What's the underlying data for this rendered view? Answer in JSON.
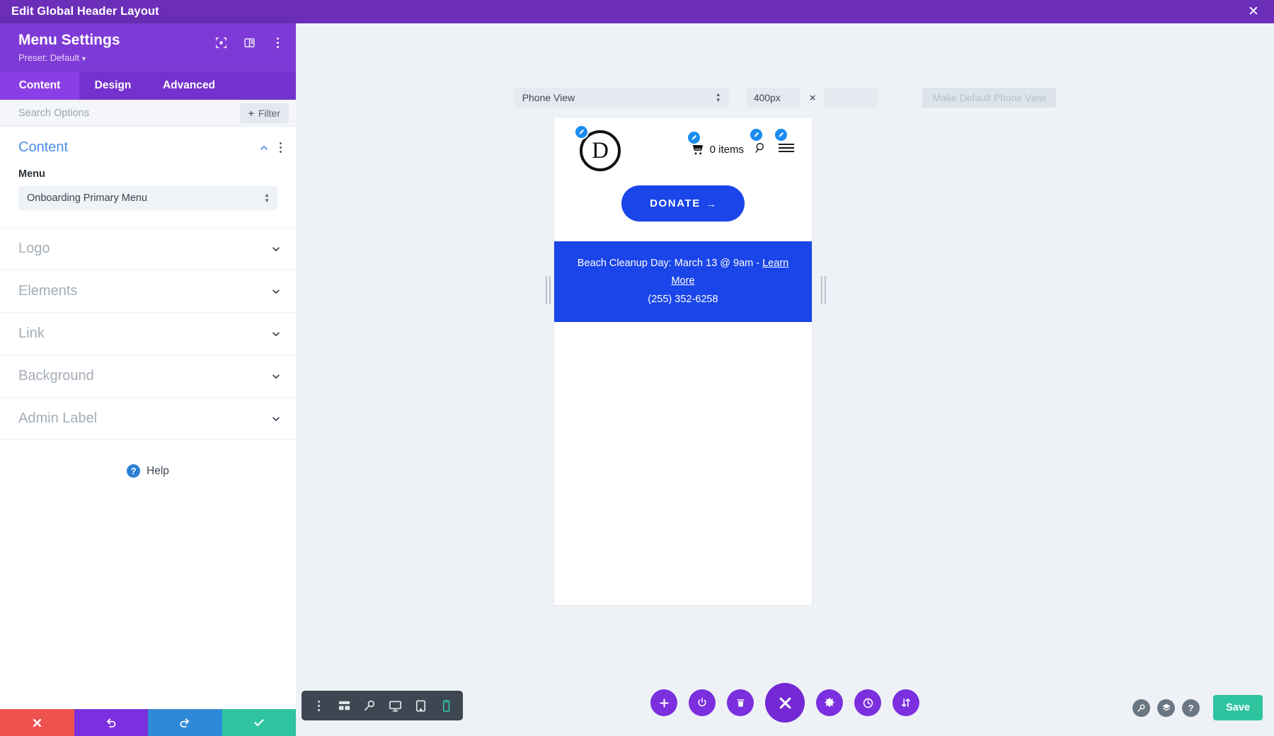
{
  "topbar": {
    "title": "Edit Global Header Layout",
    "close_icon": "close-icon"
  },
  "panel": {
    "title": "Menu Settings",
    "preset_label": "Preset: Default",
    "header_icons": [
      {
        "name": "focus-target-icon"
      },
      {
        "name": "panel-layout-icon"
      },
      {
        "name": "more-options-icon"
      }
    ],
    "tabs": [
      {
        "label": "Content",
        "active": true
      },
      {
        "label": "Design",
        "active": false
      },
      {
        "label": "Advanced",
        "active": false
      }
    ],
    "search": {
      "placeholder": "Search Options",
      "value": ""
    },
    "filter_label": "Filter",
    "sections": [
      {
        "name": "Content",
        "open": true,
        "field_label": "Menu",
        "field_value": "Onboarding Primary Menu"
      },
      {
        "name": "Logo",
        "open": false
      },
      {
        "name": "Elements",
        "open": false
      },
      {
        "name": "Link",
        "open": false
      },
      {
        "name": "Background",
        "open": false
      },
      {
        "name": "Admin Label",
        "open": false
      }
    ],
    "help_label": "Help",
    "actions": [
      {
        "name": "discard-button",
        "icon": "close-icon",
        "color": "#ef5350"
      },
      {
        "name": "undo-button",
        "icon": "undo-icon",
        "color": "#7b2fde"
      },
      {
        "name": "redo-button",
        "icon": "redo-icon",
        "color": "#2e8ad6"
      },
      {
        "name": "apply-button",
        "icon": "check-icon",
        "color": "#2ec4a0"
      }
    ]
  },
  "viewport_toolbar": {
    "view_mode": "Phone View",
    "width_value": "400px",
    "height_value": "",
    "separator": "×",
    "make_default_label": "Make Default Phone View"
  },
  "preview": {
    "logo_letter": "D",
    "cart_label": "0 items",
    "donate_label": "DONATE",
    "donate_arrow": "→",
    "banner_line1_prefix": "Beach Cleanup Day: March 13 @ 9am - ",
    "banner_link": "Learn More",
    "banner_phone": "(255) 352-6258"
  },
  "bottom_toolbar": {
    "buttons": [
      {
        "name": "more-options-icon",
        "active": false
      },
      {
        "name": "wireframe-icon",
        "active": false
      },
      {
        "name": "zoom-icon",
        "active": false
      },
      {
        "name": "desktop-view-icon",
        "active": false
      },
      {
        "name": "tablet-view-icon",
        "active": false
      },
      {
        "name": "phone-view-icon",
        "active": true
      }
    ]
  },
  "fabs": [
    {
      "name": "add-icon",
      "big": false
    },
    {
      "name": "power-icon",
      "big": false
    },
    {
      "name": "trash-icon",
      "big": false
    },
    {
      "name": "close-menu-icon",
      "big": true
    },
    {
      "name": "settings-gear-icon",
      "big": false
    },
    {
      "name": "history-clock-icon",
      "big": false
    },
    {
      "name": "sort-arrows-icon",
      "big": false
    }
  ],
  "right_controls": {
    "circles": [
      {
        "name": "zoom-icon",
        "glyph": ""
      },
      {
        "name": "layers-icon",
        "glyph": ""
      },
      {
        "name": "help-icon",
        "glyph": "?"
      }
    ],
    "save_label": "Save"
  },
  "colors": {
    "topbar_purple": "#6c2eb9",
    "panel_purple": "#7e3ad6",
    "tab_active": "#8a3fe6",
    "accent_blue": "#1a45e8",
    "badge_blue": "#1a8cf0",
    "save_teal": "#2ec4a0",
    "canvas_bg": "#eef1f6"
  }
}
